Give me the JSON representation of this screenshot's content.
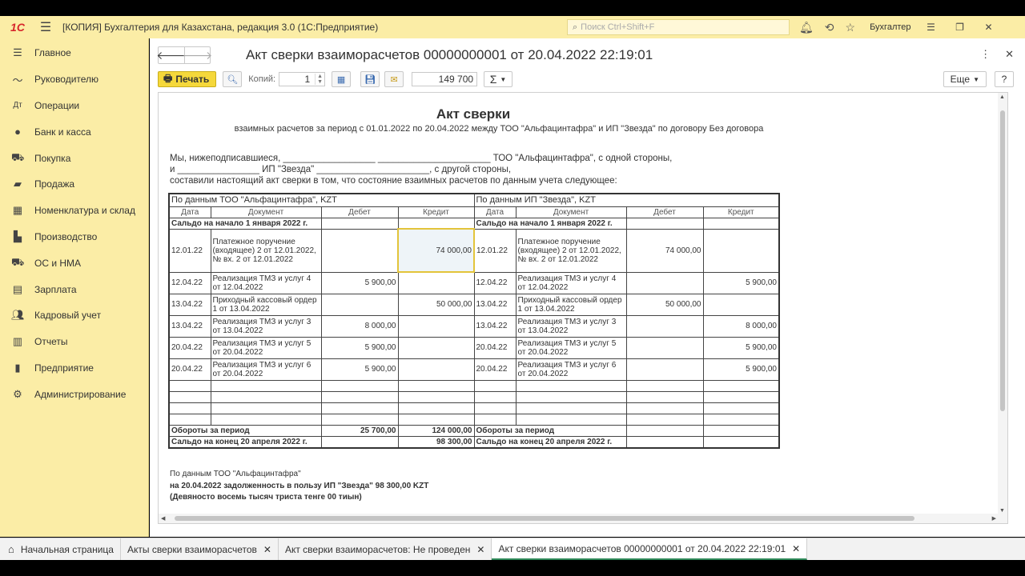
{
  "app": {
    "logo": "1С",
    "title": "[КОПИЯ] Бухгалтерия для Казахстана, редакция 3.0  (1С:Предприятие)",
    "search_placeholder": "Поиск Ctrl+Shift+F",
    "user": "Бухгалтер"
  },
  "sidebar": {
    "items": [
      {
        "label": "Главное",
        "icon": "menu-icon"
      },
      {
        "label": "Руководителю",
        "icon": "chart-line-icon"
      },
      {
        "label": "Операции",
        "icon": "operations-icon"
      },
      {
        "label": "Банк и касса",
        "icon": "bank-icon"
      },
      {
        "label": "Покупка",
        "icon": "cart-icon"
      },
      {
        "label": "Продажа",
        "icon": "bag-icon"
      },
      {
        "label": "Номенклатура и склад",
        "icon": "warehouse-icon"
      },
      {
        "label": "Производство",
        "icon": "factory-icon"
      },
      {
        "label": "ОС и НМА",
        "icon": "truck-icon"
      },
      {
        "label": "Зарплата",
        "icon": "salary-icon"
      },
      {
        "label": "Кадровый учет",
        "icon": "people-icon"
      },
      {
        "label": "Отчеты",
        "icon": "reports-icon"
      },
      {
        "label": "Предприятие",
        "icon": "enterprise-icon"
      },
      {
        "label": "Администрирование",
        "icon": "gear-icon"
      }
    ]
  },
  "doc": {
    "title": "Акт сверки взаиморасчетов 00000000001 от 20.04.2022 22:19:01"
  },
  "toolbar": {
    "print_label": "Печать",
    "copies_label": "Копий:",
    "copies_value": "1",
    "sum_value": "149 700",
    "sigma": "Σ",
    "more_label": "Еще",
    "help_label": "?"
  },
  "report": {
    "title": "Акт сверки",
    "subtitle": "взаимных расчетов за период с 01.01.2022 по 20.04.2022 между ТОО \"Альфацинтафра\" и ИП \"Звезда\" по договору Без договора",
    "line1": "Мы, нижеподписавшиеся, __________________ ______________________ ТОО \"Альфацинтафра\", с одной стороны,",
    "line2": "и ________________ ИП \"Звезда\" ______________________, с другой стороны,",
    "line3": "составили настоящий акт сверки в том, что состояние взаимных расчетов по данным учета следующее:",
    "left_header": "По данным ТОО \"Альфацинтафра\", KZT",
    "right_header": "По данным ИП \"Звезда\", KZT",
    "columns": [
      "Дата",
      "Документ",
      "Дебет",
      "Кредит"
    ],
    "opening_label": "Сальдо на начало 1 января 2022 г.",
    "rows": [
      {
        "date": "12.01.22",
        "doc": "Платежное поручение (входящее) 2 от 12.01.2022,  № вх. 2 от 12.01.2022",
        "l_debit": "",
        "l_credit": "74 000,00",
        "r_date": "12.01.22",
        "r_doc": "Платежное поручение (входящее) 2 от 12.01.2022,  № вх. 2 от 12.01.2022",
        "r_debit": "74 000,00",
        "r_credit": ""
      },
      {
        "date": "12.04.22",
        "doc": "Реализация ТМЗ и услуг 4 от 12.04.2022",
        "l_debit": "5 900,00",
        "l_credit": "",
        "r_date": "12.04.22",
        "r_doc": "Реализация ТМЗ и услуг 4 от 12.04.2022",
        "r_debit": "",
        "r_credit": "5 900,00"
      },
      {
        "date": "13.04.22",
        "doc": "Приходный кассовый ордер 1 от 13.04.2022",
        "l_debit": "",
        "l_credit": "50 000,00",
        "r_date": "13.04.22",
        "r_doc": "Приходный кассовый ордер 1 от 13.04.2022",
        "r_debit": "50 000,00",
        "r_credit": ""
      },
      {
        "date": "13.04.22",
        "doc": "Реализация ТМЗ и услуг 3 от 13.04.2022",
        "l_debit": "8 000,00",
        "l_credit": "",
        "r_date": "13.04.22",
        "r_doc": "Реализация ТМЗ и услуг 3 от 13.04.2022",
        "r_debit": "",
        "r_credit": "8 000,00"
      },
      {
        "date": "20.04.22",
        "doc": "Реализация ТМЗ и услуг 5 от 20.04.2022",
        "l_debit": "5 900,00",
        "l_credit": "",
        "r_date": "20.04.22",
        "r_doc": "Реализация ТМЗ и услуг 5 от 20.04.2022",
        "r_debit": "",
        "r_credit": "5 900,00"
      },
      {
        "date": "20.04.22",
        "doc": "Реализация ТМЗ и услуг 6 от 20.04.2022",
        "l_debit": "5 900,00",
        "l_credit": "",
        "r_date": "20.04.22",
        "r_doc": "Реализация ТМЗ и услуг 6 от 20.04.2022",
        "r_debit": "",
        "r_credit": "5 900,00"
      }
    ],
    "turnover_label": "Обороты за период",
    "turnover_debit": "25 700,00",
    "turnover_credit": "124 000,00",
    "closing_label": "Сальдо на конец 20 апреля 2022 г.",
    "closing_credit": "98 300,00",
    "footer1": "По данным ТОО \"Альфацинтафра\"",
    "footer2": "на 20.04.2022 задолженность в пользу ИП \"Звезда\"  98 300,00  KZT",
    "footer3": "(Девяносто восемь тысяч триста тенге 00 тиын)"
  },
  "tabs": [
    {
      "label": "Начальная страница",
      "closable": false
    },
    {
      "label": "Акты сверки взаиморасчетов",
      "closable": true
    },
    {
      "label": "Акт сверки взаиморасчетов: Не проведен",
      "closable": true
    },
    {
      "label": "Акт сверки взаиморасчетов 00000000001 от 20.04.2022 22:19:01",
      "closable": true
    }
  ],
  "colors": {
    "panel_yellow": "#fbeda6",
    "print_yellow": "#f5d83b",
    "active_tab": "#2f8a5a",
    "brand_red": "#d7262c"
  }
}
